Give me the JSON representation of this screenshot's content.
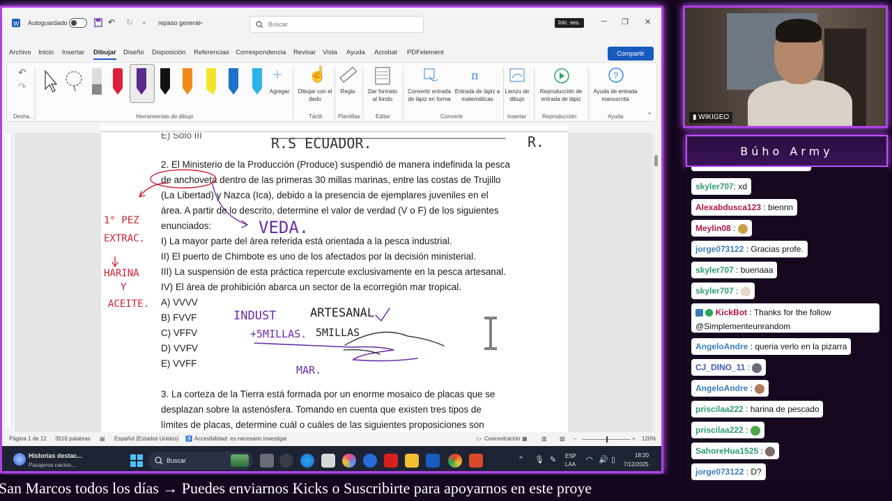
{
  "titlebar": {
    "autosave_label": "Autoguardado",
    "doc_name": "repaso general",
    "search_placeholder": "Buscar",
    "signin_label": "Inic. ses."
  },
  "menu_tabs": [
    "Archivo",
    "Inicio",
    "Insertar",
    "Dibujar",
    "Diseño",
    "Disposición",
    "Referencias",
    "Correspondencia",
    "Revisar",
    "Vista",
    "Ayuda",
    "Acrobat",
    "PDFelement"
  ],
  "share_label": "Compartir",
  "ribbon": {
    "undo_group": "Desha...",
    "draw_tools_group": "Herramientas de dibujo",
    "add_pen_label": "Agregar",
    "draw_finger_label": "Dibujar con el dedo",
    "ruler_label": "Regla",
    "format_bg_label": "Dar formato al fondo",
    "convert_shape_label": "Convertir entrada de lápiz en forma",
    "ink_math_label": "Entrada de lápiz a matemáticas",
    "canvas_label": "Lienzo de dibujo",
    "replay_label": "Reproducción de entrada de lápiz",
    "help_label": "Ayuda de entrada manuscrita",
    "group_tactil": "Táctil",
    "group_plantillas": "Plantillas",
    "group_editar": "Editar",
    "group_convertir": "Convertir",
    "group_insertar": "Insertar",
    "group_reproduccion": "Reproducción",
    "group_ayuda": "Ayuda",
    "pen_colors": [
      "#e0203a",
      "#5a2a8c",
      "#111111",
      "#f08a1a",
      "#f5e52a",
      "#1b72c8",
      "#2ab3e8"
    ]
  },
  "document": {
    "lines": [
      "2. El Ministerio de la Producción (Produce) suspendió de manera indefinida la pesca",
      "de anchoveta dentro de las primeras 30 millas marinas, entre las costas de Trujillo",
      "(La Libertad) y Nazca (Ica), debido a la presencia de ejemplares juveniles en el",
      "área. A partir de lo descrito, determine el valor de verdad (V o F) de los siguientes",
      "enunciados:",
      "I) La mayor parte del área referida está orientada a la pesca industrial.",
      "II) El puerto de Chimbote es uno de los afectados por la decisión ministerial.",
      "III) La suspensión de esta práctica repercute exclusivamente en la pesca artesanal.",
      "IV) El área de prohibición abarca un sector de la ecorregión mar tropical."
    ],
    "options": [
      "A) VVVV",
      "B) FVVF",
      "C) VFFV",
      "D) VVFV",
      "E) VVFF"
    ],
    "next_lines": [
      "3. La corteza de la Tierra está formada por un enorme mosaico de placas que se",
      "desplazan sobre la astenósfera. Tomando en cuenta que existen tres tipos de",
      "límites de placas, determine cuál o cuáles de las siguientes proposiciones son"
    ],
    "top_partial": "E) Solo III",
    "ink_notes": [
      "R.S ECUADOR.",
      "R.",
      "VEDA.",
      "1° PEZ",
      "EXTRAC.",
      "HARINA",
      "Y",
      "ACEITE.",
      "INDUST",
      "ARTESANAL",
      "+5MILLAS.",
      "5MILLAS",
      "MAR."
    ]
  },
  "status": {
    "page": "Página 1 de 12",
    "words": "3516 palabras",
    "language": "Español (Estados Unidos)",
    "accessibility": "Accesibilidad: es necesario investigar",
    "focus": "Concentración",
    "zoom": "120%"
  },
  "taskbar": {
    "news_title": "Historias destac...",
    "news_sub": "Pasajeros nacion...",
    "search_label": "Buscar",
    "lang": "ESP",
    "lang2": "LAA",
    "time": "18:20",
    "date": "7/12/2025"
  },
  "ticker": "San Marcos todos los días  →  Puedes enviarnos Kicks o Suscribirte para apoyarnos en este proye",
  "webcam_label": "WIKIGEO",
  "chat": {
    "title": "Búho Army",
    "messages": [
      {
        "user": "skyler707",
        "color": "#2e9a78",
        "text": ": xd"
      },
      {
        "user": "Alexabdusca123",
        "color": "#b01842",
        "text": ": biennn"
      },
      {
        "user": "Meylin08",
        "color": "#b01842",
        "text": ":"
      },
      {
        "user": "jorge073122",
        "color": "#3a7cb8",
        "text": ": Gracias profe."
      },
      {
        "user": "skyler707",
        "color": "#2e9a78",
        "text": ": buenaaa"
      },
      {
        "user": "skyler707",
        "color": "#2e9a78",
        "text": ":"
      },
      {
        "user": "KickBot",
        "color": "#b01842",
        "text": ": Thanks for the follow",
        "text2": "@Simplementeunrandom"
      },
      {
        "user": "AngeloAndre",
        "color": "#3a7cb8",
        "text": ": queria verlo en la pizarra"
      },
      {
        "user": "CJ_DINO_11",
        "color": "#3a5ab8",
        "text": ":"
      },
      {
        "user": "AngeloAndre",
        "color": "#3a7cb8",
        "text": ":"
      },
      {
        "user": "priscilaa222",
        "color": "#2e9a78",
        "text": ": harina de pescado"
      },
      {
        "user": "priscilaa222",
        "color": "#2e9a78",
        "text": ":"
      },
      {
        "user": "SahoreHua1525",
        "color": "#2e9a78",
        "text": ":"
      },
      {
        "user": "jorge073122",
        "color": "#3a7cb8",
        "text": ": D?"
      }
    ]
  }
}
